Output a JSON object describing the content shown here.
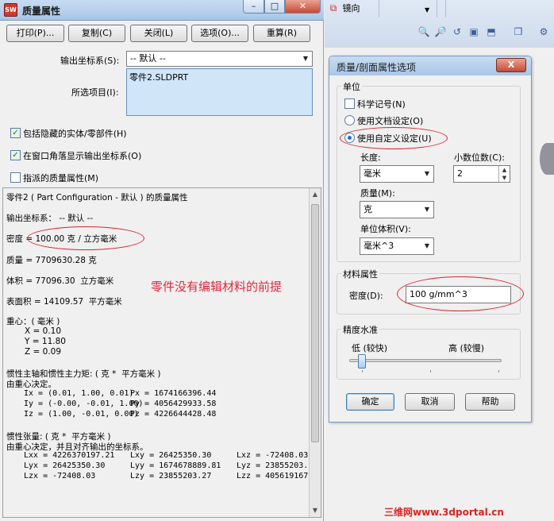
{
  "mass_props": {
    "title": "质量属性",
    "title_icon": "SW",
    "buttons": {
      "print": "打印(P)...",
      "copy": "复制(C)",
      "close": "关闭(L)",
      "options": "选项(O)...",
      "recalc": "重算(R)"
    },
    "output_cs_label": "输出坐标系(S):",
    "output_cs_value": "-- 默认 --",
    "selected_items_label": "所选项目(I):",
    "selected_items": [
      "零件2.SLDPRT"
    ],
    "checkboxes": [
      {
        "label": "包括隐藏的实体/零部件(H)",
        "checked": true
      },
      {
        "label": "在窗口角落显示输出坐标系(O)",
        "checked": true
      },
      {
        "label": "指派的质量属性(M)",
        "checked": false
      }
    ],
    "results": {
      "header": "零件2 ( Part Configuration - 默认 ) 的质量属性",
      "output_cs": "输出坐标系： -- 默认 --",
      "density": "密度 = 100.00 克 / 立方毫米",
      "mass": "质量 = 7709630.28 克",
      "volume": "体积 = 77096.30  立方毫米",
      "surface_area": "表面积 = 14109.57  平方毫米",
      "cog_title": "重心：( 毫米 )",
      "cog_x": "X = 0.10",
      "cog_y": "Y = 11.80",
      "cog_z": "Z = 0.09",
      "principal_title": "惯性主轴和惯性主力矩: ( 克 *  平方毫米 )",
      "principal_sub": "由重心决定。",
      "ix": "Ix = (0.01, 1.00, 0.01)",
      "iy": "Iy = (-0.00, -0.01, 1.00)",
      "iz": "Iz = (1.00, -0.01, 0.00)",
      "px": "Px = 1674166396.44",
      "py": "Py = 4056429933.58",
      "pz": "Pz = 4226644428.48",
      "tensor_title": "惯性张量: ( 克 *  平方毫米 )",
      "tensor_sub": "由重心决定，并且对齐输出的坐标系。",
      "lxx": "Lxx = 4226370197.21",
      "lxy": "Lxy = 26425350.30",
      "lxz": "Lxz = -72408.03",
      "lyx": "Lyx = 26425350.30",
      "lyy": "Lyy = 1674678889.81",
      "lyz": "Lyz = 23855203.",
      "lzx": "Lzx = -72408.03",
      "lzy": "Lzy = 23855203.27",
      "lzz": "Lzz = 405619167"
    },
    "annotation": "零件没有编辑材料的前提"
  },
  "toolbar": {
    "mirror_label": "镜向",
    "icons": [
      "zoom-fit-icon",
      "zoom-area-icon",
      "previous-view-icon",
      "section-view-icon",
      "view-orientation-icon",
      "display-style-icon"
    ]
  },
  "options_dialog": {
    "title": "质量/剖面属性选项",
    "close_label": "X",
    "units_group": "单位",
    "scientific": {
      "label": "科学记号(N)",
      "checked": false
    },
    "use_doc": {
      "label": "使用文档设定(O)",
      "checked": false
    },
    "use_custom": {
      "label": "使用自定义设定(U)",
      "checked": true
    },
    "length_label": "长度:",
    "length_value": "毫米",
    "decimals_label": "小数位数(C):",
    "decimals_value": "2",
    "mass_label": "质量(M):",
    "mass_value": "克",
    "unit_volume_label": "单位体积(V):",
    "unit_volume_value": "毫米^3",
    "material_group": "材料属性",
    "density_label": "密度(D):",
    "density_value": "100 g/mm^3",
    "accuracy_group": "精度水准",
    "low_label": "低 (较快)",
    "high_label": "高 (较慢)",
    "accuracy_level": 0,
    "ok": "确定",
    "cancel": "取消",
    "help": "帮助"
  },
  "watermark": "三维网www.3dportal.cn",
  "colors": {
    "annotation_red": "#d2262e",
    "title_bar": "#c7dcf2",
    "listbox_bg": "#d0e6f8"
  }
}
